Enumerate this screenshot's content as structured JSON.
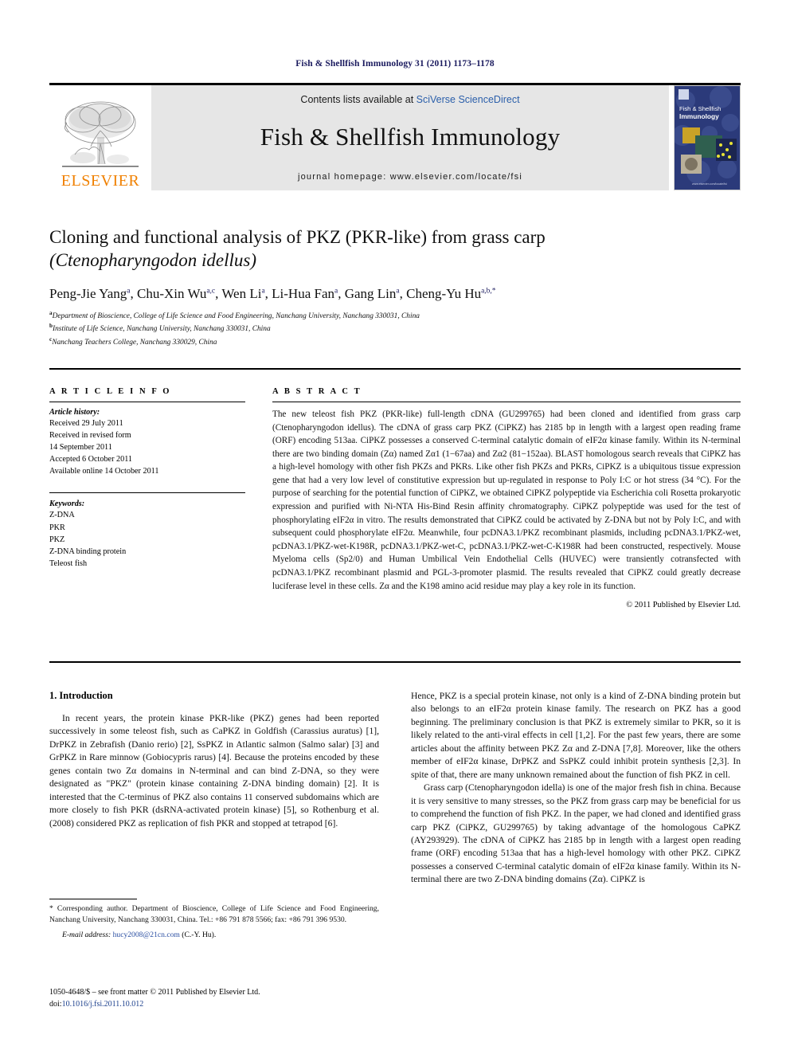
{
  "running_head": "Fish & Shellfish Immunology 31 (2011) 1173–1178",
  "masthead": {
    "publisher_name": "ELSEVIER",
    "contents_prefix": "Contents lists available at ",
    "contents_link": "SciVerse ScienceDirect",
    "journal_title": "Fish & Shellfish Immunology",
    "homepage_label": "journal homepage: www.elsevier.com/locate/fsi",
    "cover": {
      "line1": "Fish & Shellfish",
      "line2": "Immunology",
      "footer": "www.elsevier.com/locate/fsi"
    }
  },
  "article": {
    "title_line1": "Cloning and functional analysis of PKZ (PKR-like) from grass carp",
    "title_species": "(Ctenopharyngodon idellus)",
    "authors": [
      {
        "name": "Peng-Jie Yang",
        "sup": "a"
      },
      {
        "name": "Chu-Xin Wu",
        "sup": "a,c"
      },
      {
        "name": "Wen Li",
        "sup": "a"
      },
      {
        "name": "Li-Hua Fan",
        "sup": "a"
      },
      {
        "name": "Gang Lin",
        "sup": "a"
      },
      {
        "name": "Cheng-Yu Hu",
        "sup": "a,b,*"
      }
    ],
    "affiliations": [
      {
        "mark": "a",
        "text": "Department of Bioscience, College of Life Science and Food Engineering, Nanchang University, Nanchang 330031, China"
      },
      {
        "mark": "b",
        "text": "Institute of Life Science, Nanchang University, Nanchang 330031, China"
      },
      {
        "mark": "c",
        "text": "Nanchang Teachers College, Nanchang 330029, China"
      }
    ]
  },
  "article_info": {
    "heading": "A R T I C L E   I N F O",
    "history_label": "Article history:",
    "history_lines": [
      "Received 29 July 2011",
      "Received in revised form",
      "14 September 2011",
      "Accepted 6 October 2011",
      "Available online 14 October 2011"
    ],
    "keywords_label": "Keywords:",
    "keywords": [
      "Z-DNA",
      "PKR",
      "PKZ",
      "Z-DNA binding protein",
      "Teleost fish"
    ]
  },
  "abstract": {
    "heading": "A B S T R A C T",
    "paragraphs": [
      "The new teleost fish PKZ (PKR-like) full-length cDNA (GU299765) had been cloned and identified from grass carp (Ctenopharyngodon idellus). The cDNA of grass carp PKZ (CiPKZ) has 2185 bp in length with a largest open reading frame (ORF) encoding 513aa. CiPKZ possesses a conserved C-terminal catalytic domain of eIF2α kinase family. Within its N-terminal there are two binding domain (Zα) named Zα1 (1−67aa) and Zα2 (81−152aa). BLAST homologous search reveals that CiPKZ has a high-level homology with other fish PKZs and PKRs. Like other fish PKZs and PKRs, CiPKZ is a ubiquitous tissue expression gene that had a very low level of constitutive expression but up-regulated in response to Poly I:C or hot stress (34 °C). For the purpose of searching for the potential function of CiPKZ, we obtained CiPKZ polypeptide via Escherichia coli Rosetta prokaryotic expression and purified with Ni-NTA His-Bind Resin affinity chromatography. CiPKZ polypeptide was used for the test of phosphorylating eIF2α in vitro. The results demonstrated that CiPKZ could be activated by Z-DNA but not by Poly I:C, and with subsequent could phosphorylate eIF2α. Meanwhile, four pcDNA3.1/PKZ recombinant plasmids, including pcDNA3.1/PKZ-wet, pcDNA3.1/PKZ-wet-K198R, pcDNA3.1/PKZ-wet-C, pcDNA3.1/PKZ-wet-C-K198R had been constructed, respectively. Mouse Myeloma cells (Sp2/0) and Human Umbilical Vein Endothelial Cells (HUVEC) were transiently cotransfected with pcDNA3.1/PKZ recombinant plasmid and PGL-3-promoter plasmid. The results revealed that CiPKZ could greatly decrease luciferase level in these cells. Zα and the K198 amino acid residue may play a key role in its function."
    ],
    "copyright": "© 2011 Published by Elsevier Ltd."
  },
  "body": {
    "section_number_title": "1.  Introduction",
    "left_paragraphs": [
      "In recent years, the protein kinase PKR-like (PKZ) genes had been reported successively in some teleost fish, such as CaPKZ in Goldfish (Carassius auratus) [1], DrPKZ in Zebrafish (Danio rerio) [2], SsPKZ in Atlantic salmon (Salmo salar) [3] and GrPKZ in Rare minnow (Gobiocypris rarus) [4]. Because the proteins encoded by these genes contain two Zα domains in N-terminal and can bind Z-DNA, so they were designated as \"PKZ\" (protein kinase containing Z-DNA binding domain) [2]. It is interested that the C-terminus of PKZ also contains 11 conserved subdomains which are more closely to fish PKR (dsRNA-activated protein kinase) [5], so Rothenburg et al. (2008) considered PKZ as replication of fish PKR and stopped at tetrapod [6]."
    ],
    "right_paragraphs": [
      "Hence, PKZ is a special protein kinase, not only is a kind of Z-DNA binding protein but also belongs to an eIF2α protein kinase family. The research on PKZ has a good beginning. The preliminary conclusion is that PKZ is extremely similar to PKR, so it is likely related to the anti-viral effects in cell [1,2]. For the past few years, there are some articles about the affinity between PKZ Zα and Z-DNA [7,8]. Moreover, like the others member of eIF2α kinase, DrPKZ and SsPKZ could inhibit protein synthesis [2,3]. In spite of that, there are many unknown remained about the function of fish PKZ in cell.",
      "Grass carp (Ctenopharyngodon idella) is one of the major fresh fish in china. Because it is very sensitive to many stresses, so the PKZ from grass carp may be beneficial for us to comprehend the function of fish PKZ. In the paper, we had cloned and identified grass carp PKZ (CiPKZ, GU299765) by taking advantage of the homologous CaPKZ (AY293929). The cDNA of CiPKZ has 2185 bp in length with a largest open reading frame (ORF) encoding 513aa that has a high-level homology with other PKZ. CiPKZ possesses a conserved C-terminal catalytic domain of eIF2α kinase family. Within its N-terminal there are two Z-DNA binding domains (Zα). CiPKZ is"
    ]
  },
  "footnote": {
    "corresponding": "* Corresponding author. Department of Bioscience, College of Life Science and Food Engineering, Nanchang University, Nanchang 330031, China. Tel.: +86 791 878 5566; fax: +86 791 396 9530.",
    "email_label": "E-mail address:",
    "email": "hucy2008@21cn.com",
    "email_suffix": "(C.-Y. Hu)."
  },
  "issn": {
    "line1": "1050-4648/$ – see front matter © 2011 Published by Elsevier Ltd.",
    "doi_prefix": "doi:",
    "doi": "10.1016/j.fsi.2011.10.012"
  },
  "colors": {
    "link_blue": "#2b5faa",
    "ref_blue": "#2b4fa2",
    "running_head_navy": "#1a1a5e",
    "elsevier_orange": "#F08000",
    "band_gray": "#e6e6e6",
    "cover_navy": "#2b3a7a"
  }
}
